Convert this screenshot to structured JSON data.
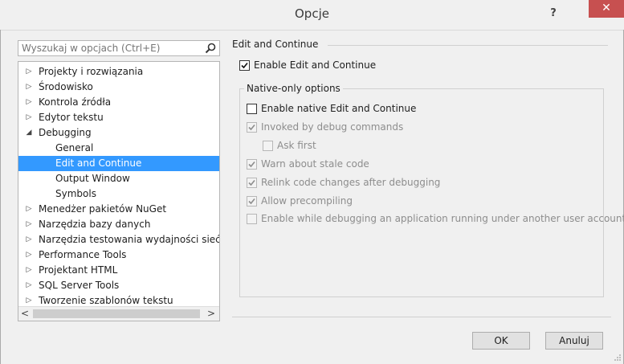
{
  "window": {
    "title": "Opcje",
    "help_label": "?",
    "close_label": "✕"
  },
  "search": {
    "placeholder": "Wyszukaj w opcjach (Ctrl+E)"
  },
  "tree": {
    "items": [
      {
        "label": "Projekty i rozwiązania",
        "expander": "▷"
      },
      {
        "label": "Środowisko",
        "expander": "▷"
      },
      {
        "label": "Kontrola źródła",
        "expander": "▷"
      },
      {
        "label": "Edytor tekstu",
        "expander": "▷"
      },
      {
        "label": "Debugging",
        "expander": "◢"
      },
      {
        "label": "General"
      },
      {
        "label": "Edit and Continue",
        "selected": true
      },
      {
        "label": "Output Window"
      },
      {
        "label": "Symbols"
      },
      {
        "label": "Menedżer pakietów NuGet",
        "expander": "▷"
      },
      {
        "label": "Narzędzia bazy danych",
        "expander": "▷"
      },
      {
        "label": "Narzędzia testowania wydajności sieć Web",
        "expander": "▷"
      },
      {
        "label": "Performance Tools",
        "expander": "▷"
      },
      {
        "label": "Projektant HTML",
        "expander": "▷"
      },
      {
        "label": "SQL Server Tools",
        "expander": "▷"
      },
      {
        "label": "Tworzenie szablonów tekstu",
        "expander": "▷"
      }
    ],
    "scroll_left": "<",
    "scroll_right": ">"
  },
  "panel": {
    "section_title": "Edit and Continue",
    "enable_edit_continue": {
      "label": "Enable Edit and Continue",
      "checked": true
    },
    "group_title": "Native-only options",
    "options": {
      "enable_native": {
        "label": "Enable native Edit and Continue",
        "checked": false
      },
      "invoked_by_debug": {
        "label": "Invoked by debug commands",
        "checked": true
      },
      "ask_first": {
        "label": "Ask first",
        "checked": false
      },
      "warn_stale": {
        "label": "Warn about stale code",
        "checked": true
      },
      "relink": {
        "label": "Relink code changes after debugging",
        "checked": true
      },
      "precompile": {
        "label": "Allow precompiling",
        "checked": true
      },
      "enable_other_user": {
        "label": "Enable while debugging an application running under another user account",
        "checked": false
      }
    }
  },
  "buttons": {
    "ok": "OK",
    "cancel": "Anuluj"
  },
  "colors": {
    "accent": "#3399ff",
    "close": "#c75050"
  }
}
